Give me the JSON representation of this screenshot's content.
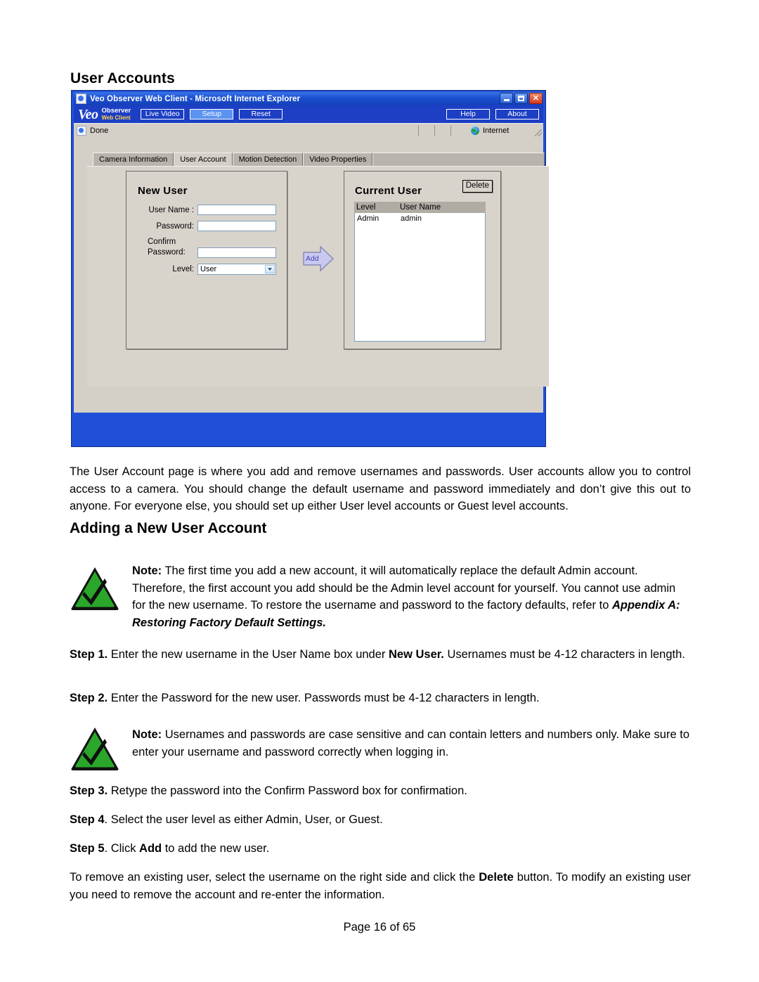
{
  "document": {
    "heading1": "User Accounts",
    "heading2": "Adding a New User Account",
    "intro_paragraph": "The User Account page is where you add and remove usernames and passwords. User accounts allow you to control access to a camera. You should change the default username and password immediately and don’t give this out to anyone. For everyone else, you should set up either User level accounts or Guest level accounts.",
    "closing_paragraph_before_bold": "To remove an existing user, select the username on the right side and click the ",
    "closing_bold": "Delete",
    "closing_paragraph_after_bold": " button. To modify an existing user you need to remove the account and re-enter the information.",
    "footer": "Page 16 of 65"
  },
  "notes": [
    {
      "icon": "note-check-triangle-icon",
      "label": "Note:",
      "text": " The first time you add a new account, it will automatically replace the default Admin account. Therefore, the first account you add should be the Admin level account for yourself. You cannot use admin for the new username. To restore the username and password to the factory defaults, refer to ",
      "reference": "Appendix A: Restoring Factory Default Settings."
    },
    {
      "icon": "note-check-triangle-icon",
      "label": "Note:",
      "text": " Usernames and passwords are case sensitive and can contain letters and numbers only. Make sure to enter your username and password correctly when logging in.",
      "reference": ""
    }
  ],
  "steps": [
    {
      "label": "Step 1.",
      "part1": " Enter the new username in the User Name box under ",
      "bold": "New User.",
      "part2": "  Usernames must be 4-12 characters in length."
    },
    {
      "label": "Step 2.",
      "part1": " Enter the Password for the new user. Passwords must be 4-12 characters in length.",
      "bold": "",
      "part2": ""
    },
    {
      "label": "Step 3.",
      "part1": " Retype the password into the Confirm Password box for confirmation.",
      "bold": "",
      "part2": ""
    },
    {
      "label": "Step 4",
      "part1": ". Select the user level as either Admin, User, or Guest.",
      "bold": "",
      "part2": ""
    },
    {
      "label": "Step 5",
      "part1": ". Click ",
      "bold": "Add",
      "part2": " to add the new user."
    }
  ],
  "browser": {
    "title": "Veo Observer Web Client - Microsoft Internet Explorer",
    "title_icon": "ie-document-icon",
    "window_controls": {
      "minimize": "minimize-icon",
      "maximize": "maximize-icon",
      "close": "✕"
    },
    "status": {
      "text": "Done",
      "status_icon": "ie-document-icon",
      "zone": "Internet",
      "zone_icon": "internet-globe-icon"
    }
  },
  "app": {
    "logo": {
      "brand": "Veo",
      "line1": "Observer",
      "line2": "Web Client"
    },
    "toolbar_left": [
      {
        "label": "Live Video",
        "active": false
      },
      {
        "label": "Setup",
        "active": true
      },
      {
        "label": "Reset",
        "active": false
      }
    ],
    "toolbar_right": [
      {
        "label": "Help"
      },
      {
        "label": "About"
      }
    ],
    "tabs": [
      {
        "label": "Camera Information",
        "active": false
      },
      {
        "label": "User Account",
        "active": true
      },
      {
        "label": "Motion Detection",
        "active": false
      },
      {
        "label": "Video Properties",
        "active": false
      }
    ],
    "new_user": {
      "title": "New User",
      "fields": [
        {
          "label": "User Name :",
          "value": "",
          "type": "text"
        },
        {
          "label": "Password:",
          "value": "",
          "type": "text"
        },
        {
          "label": "Confirm\nPassword:",
          "value": "",
          "type": "text"
        }
      ],
      "level_label": "Level:",
      "level_value": "User",
      "add_button": "Add"
    },
    "current_user": {
      "title": "Current User",
      "delete_button": "Delete",
      "columns": [
        "Level",
        "User Name"
      ],
      "rows": [
        {
          "level": "Admin",
          "username": "admin"
        }
      ]
    }
  },
  "colors": {
    "titlebar_blue": "#1a4fd0",
    "toolbar_blue": "#1d3fc4",
    "active_button_blue": "#5b93f0",
    "window_gray": "#d4d0c8",
    "tab_inactive": "#b8b4ac",
    "add_arrow_fill": "#c9c9f0",
    "note_green": "#2aa72a",
    "logo_yellow": "#ffd24a"
  }
}
